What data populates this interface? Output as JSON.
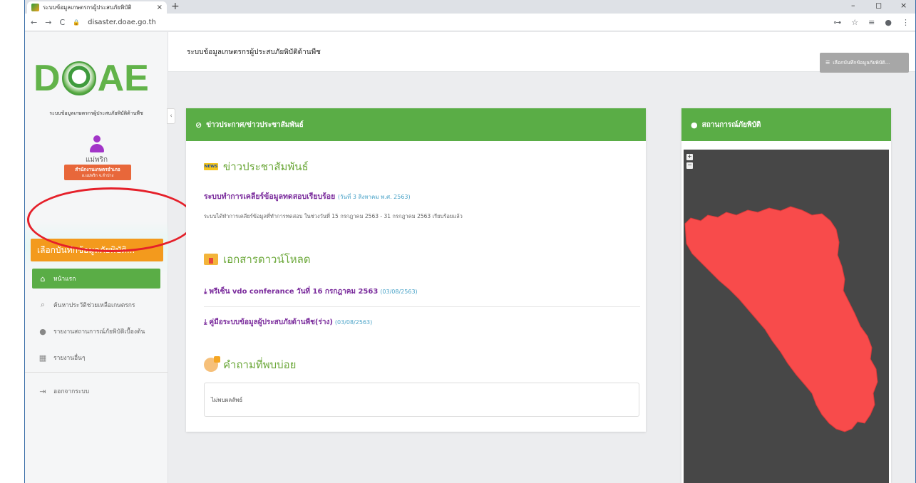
{
  "browser": {
    "tab_title": "ระบบข้อมูลเกษตรกรผู้ประสบภัยพิบัติ",
    "tab_close": "×",
    "new_tab": "+",
    "url": "disaster.doae.go.th",
    "nav_back": "←",
    "nav_forward": "→",
    "nav_reload": "C",
    "lock": "🔒",
    "win_min": "–",
    "win_max": "◻",
    "win_close": "×",
    "key_icon": "⊶",
    "star_icon": "☆",
    "queue_icon": "≡",
    "profile_icon": "●",
    "menu_icon": "⋮"
  },
  "sidebar": {
    "logo_left": "D",
    "logo_right": "AE",
    "subtitle": "ระบบข้อมูลเกษตรกรผู้ประสบภัยพิบัติด้านพืช",
    "collapse": "‹",
    "user_name": "แม่พริก",
    "office_line1": "สำนักงานเกษตรอำเภอ",
    "office_line2": "อ.แม่พริก จ.ลำปาง",
    "select_button": "เลือกบันทึกข้อมูลภัยพิบัติ...",
    "items": [
      {
        "label": "หน้าแรก",
        "icon": "home-icon",
        "glyph": "⌂"
      },
      {
        "label": "ค้นหาประวัติช่วยเหลือเกษตรกร",
        "icon": "search-icon",
        "glyph": "⌕"
      },
      {
        "label": "รายงานสถานการณ์ภัยพิบัติเบื้องต้น",
        "icon": "info-icon",
        "glyph": "●"
      },
      {
        "label": "รายงานอื่นๆ",
        "icon": "table-icon",
        "glyph": "▦"
      }
    ],
    "logout": {
      "label": "ออกจากระบบ",
      "glyph": "⇥"
    }
  },
  "topbar": {
    "title": "ระบบข้อมูลเกษตรกรผู้ประสบภัยพิบัติด้านพืช",
    "button": "เลือกบันทึกข้อมูลภัยพิบัติ...",
    "button_icon": "☰"
  },
  "news_card": {
    "header": "ข่าวประกาศ/ข่าวประชาสัมพันธ์",
    "header_icon": "⊘",
    "pr_heading": "ข่าวประชาสัมพันธ์",
    "pr_badge": "NEWS",
    "news_title": "ระบบทำการเคลียร์ข้อมูลทดสอบเรียบร้อย",
    "news_date": "(วันที่ 3 สิงหาคม พ.ศ. 2563)",
    "news_desc": "ระบบได้ทำการเคลียร์ข้อมูลที่ทำการทดสอบ ในช่วงวันที่ 15 กรกฎาคม 2563 - 31 กรกฎาคม 2563 เรียบร้อยแล้ว",
    "downloads_heading": "เอกสารดาวน์โหลด",
    "download_glyph": "⤓",
    "downloads": [
      {
        "title": "พรีเซ็น vdo conferance วันที่ 16 กรกฎาคม 2563",
        "date": "(03/08/2563)"
      },
      {
        "title": "คู่มือระบบข้อมูลผู้ประสบภัยด้านพืช(ร่าง)",
        "date": "(03/08/2563)"
      }
    ],
    "faq_heading": "คำถามที่พบบ่อย",
    "faq_empty": "ไม่พบผลลัพธ์"
  },
  "disaster_card": {
    "header": "สถานการณ์ภัยพิบัติ",
    "header_icon": "●",
    "zoom_in": "+",
    "zoom_out": "−"
  },
  "colors": {
    "green": "#5aad46",
    "orange": "#f39a1d",
    "purple": "#7a2b9c",
    "map_fill": "#f84b4b",
    "annotation_ring": "#e5202a"
  }
}
